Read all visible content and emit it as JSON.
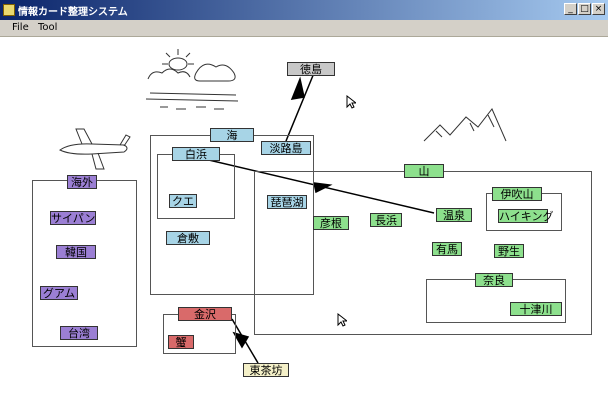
{
  "window": {
    "title": "情報カード整理システム",
    "buttons": [
      "_",
      "□",
      "×"
    ]
  },
  "menu": {
    "file": "File",
    "tool": "Tool"
  },
  "cards": {
    "tokushima": "徳島",
    "umi": "海",
    "shirahama": "白浜",
    "awajishima": "淡路島",
    "kue": "クエ",
    "biwako": "琵琶湖",
    "kurashiki": "倉敷",
    "kaigai": "海外",
    "saipan": "サイパン",
    "kankoku": "韓国",
    "guam": "グアム",
    "taiwan": "台湾",
    "yama": "山",
    "ibukiyama": "伊吹山",
    "hiking": "ハイキング",
    "onsen": "温泉",
    "arima": "有馬",
    "hikone": "彦根",
    "nagahama": "長浜",
    "yagyu": "野生",
    "nara": "奈良",
    "tozugawa": "十津川",
    "kanazawa": "金沢",
    "kani": "蟹",
    "higashi_chaya": "東茶坊"
  }
}
